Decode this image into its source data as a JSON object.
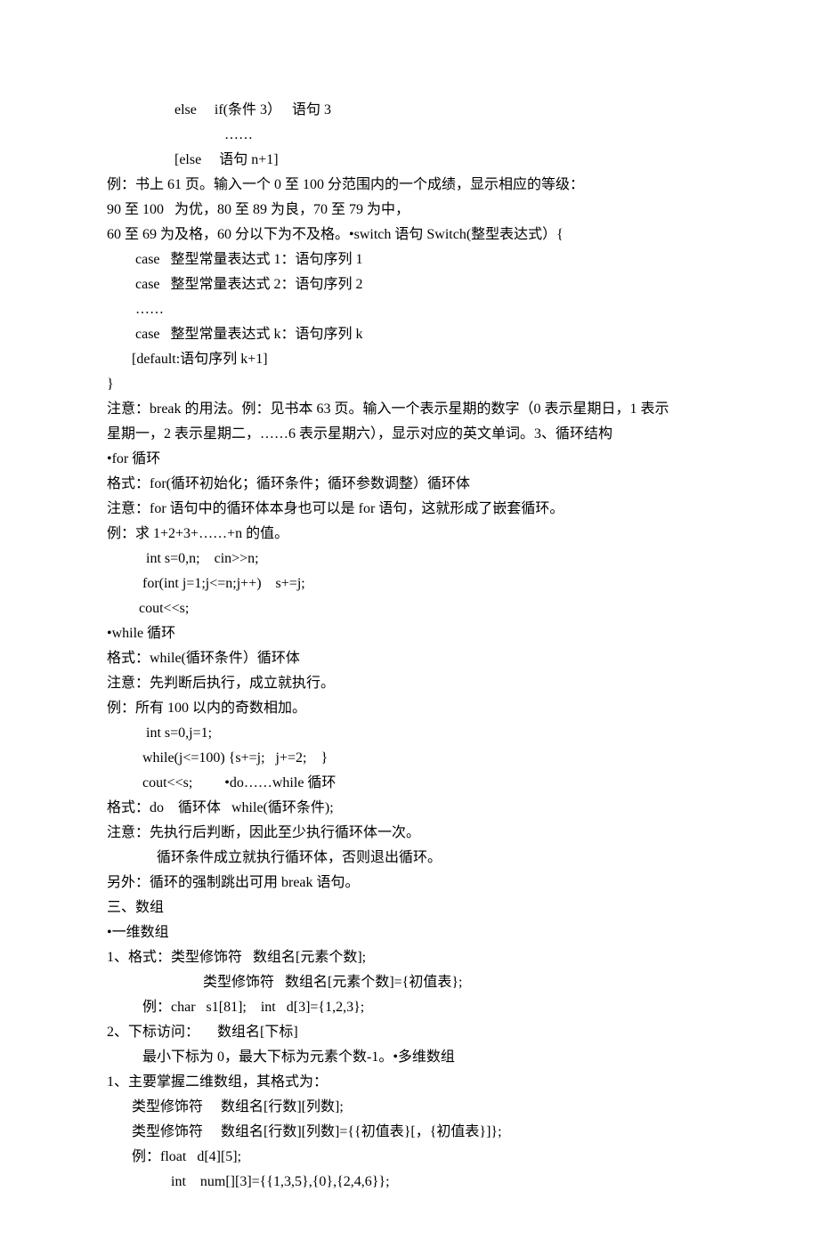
{
  "lines": [
    "                   else     if(条件 3）   语句 3",
    "                                 ……",
    "                   [else     语句 n+1]",
    "例：书上 61 页。输入一个 0 至 100 分范围内的一个成绩，显示相应的等级：",
    "90 至 100   为优，80 至 89 为良，70 至 79 为中，",
    "60 至 69 为及格，60 分以下为不及格。•switch 语句 Switch(整型表达式）{",
    "        case   整型常量表达式 1：语句序列 1",
    "        case   整型常量表达式 2：语句序列 2",
    "        ……",
    "        case   整型常量表达式 k：语句序列 k",
    "       [default:语句序列 k+1]",
    "}",
    "注意：break 的用法。例：见书本 63 页。输入一个表示星期的数字（0 表示星期日，1 表示",
    "星期一，2 表示星期二，……6 表示星期六），显示对应的英文单词。3、循环结构",
    "•for 循环",
    "格式：for(循环初始化；循环条件；循环参数调整）循环体",
    "注意：for 语句中的循环体本身也可以是 for 语句，这就形成了嵌套循环。",
    "例：求 1+2+3+……+n 的值。",
    "           int s=0,n;    cin>>n;",
    "          for(int j=1;j<=n;j++)    s+=j;",
    "         cout<<s;",
    "•while 循环",
    "格式：while(循环条件）循环体",
    "注意：先判断后执行，成立就执行。",
    "例：所有 100 以内的奇数相加。",
    "           int s=0,j=1;",
    "          while(j<=100) {s+=j;   j+=2;    }",
    "          cout<<s;         •do……while 循环",
    "格式：do    循环体   while(循环条件);",
    "注意：先执行后判断，因此至少执行循环体一次。",
    "              循环条件成立就执行循环体，否则退出循环。",
    "另外：循环的强制跳出可用 break 语句。",
    "三、数组",
    "•一维数组",
    "1、格式：类型修饰符   数组名[元素个数];",
    "                           类型修饰符   数组名[元素个数]={初值表};",
    "          例：char   s1[81];    int   d[3]={1,2,3};",
    "2、下标访问：     数组名[下标]",
    "          最小下标为 0，最大下标为元素个数-1。•多维数组",
    "1、主要掌握二维数组，其格式为：",
    "       类型修饰符     数组名[行数][列数];",
    "       类型修饰符     数组名[行数][列数]={{初值表}[，{初值表}]};",
    "       例：float   d[4][5];",
    "                  int    num[][3]={{1,3,5},{0},{2,4,6}};"
  ]
}
